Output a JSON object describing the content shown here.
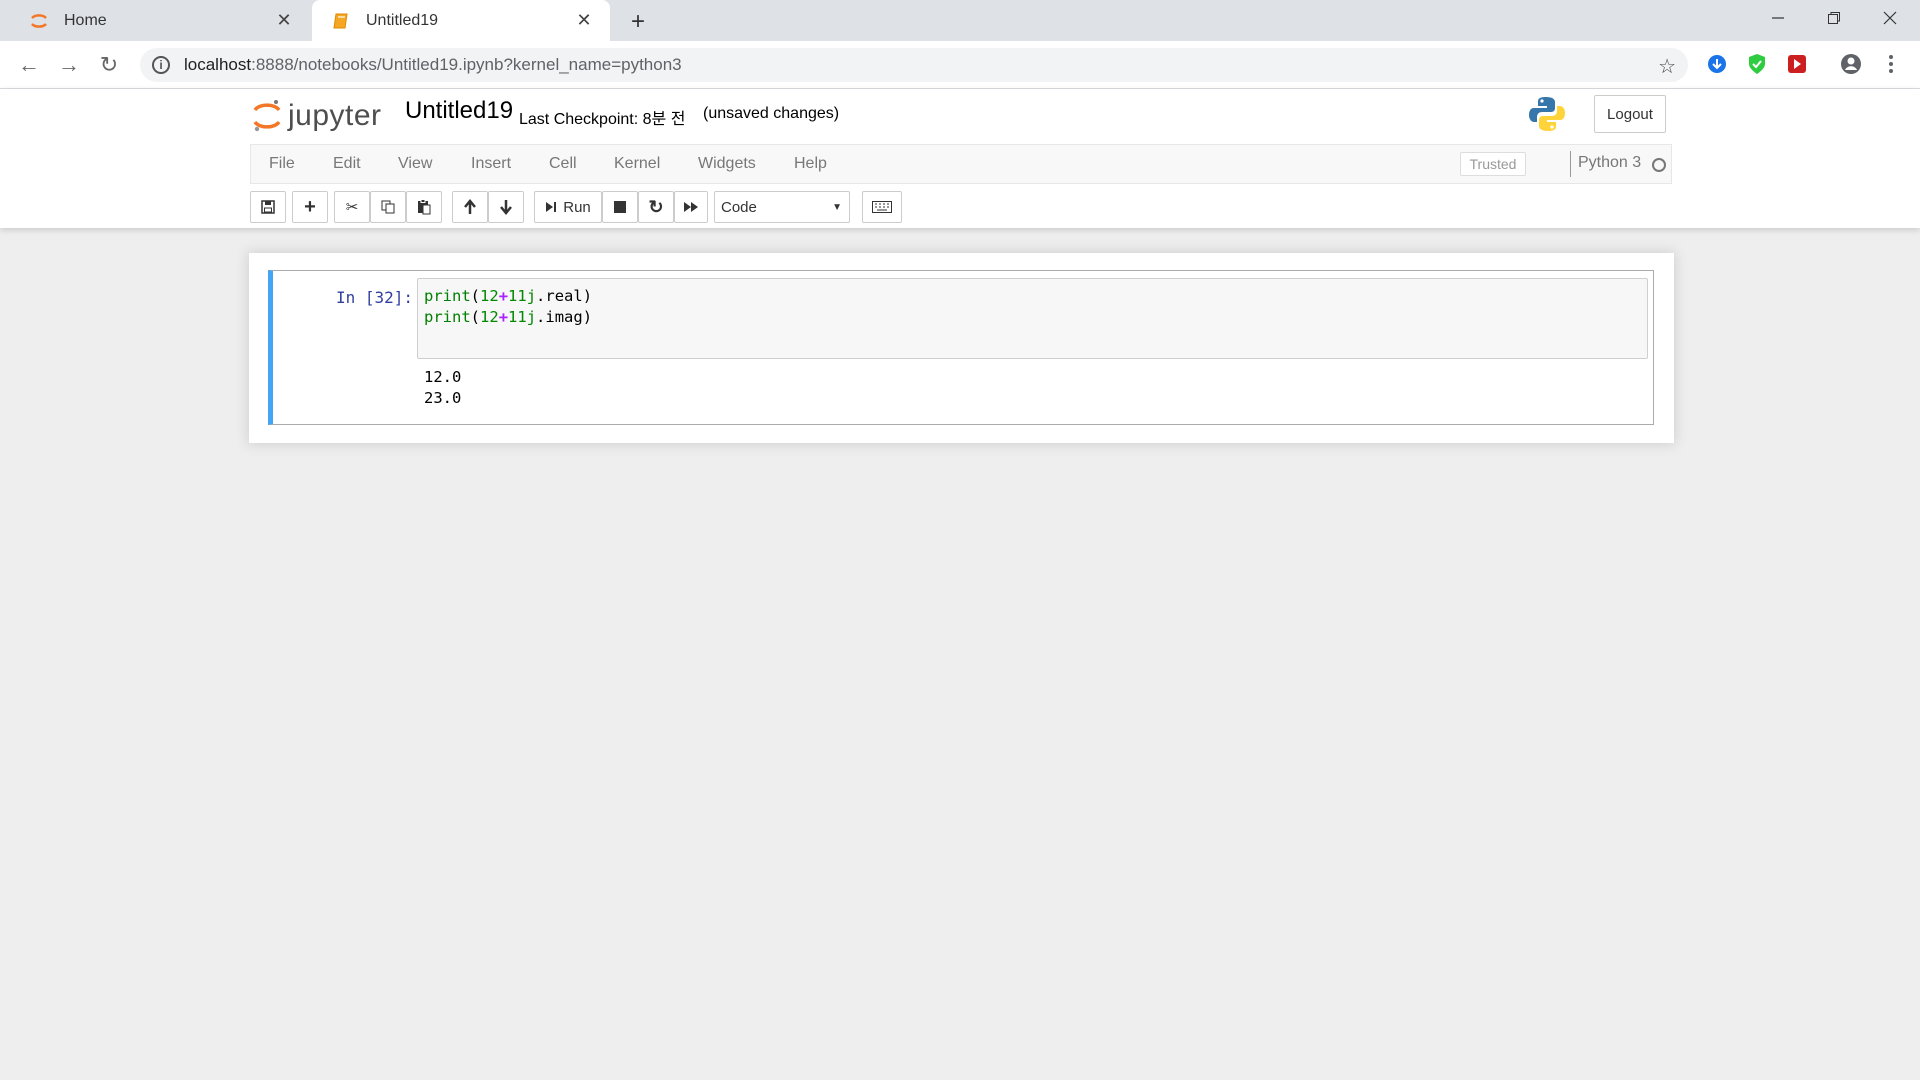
{
  "browser": {
    "tabs": [
      {
        "label": "Home",
        "icon": "jupyter-icon",
        "active": false
      },
      {
        "label": "Untitled19",
        "icon": "notebook-icon",
        "active": true
      }
    ],
    "url": {
      "host": "localhost",
      "rest": ":8888/notebooks/Untitled19.ipynb?kernel_name=python3"
    }
  },
  "header": {
    "logo_text": "jupyter",
    "notebook_name": "Untitled19",
    "checkpoint": "Last Checkpoint: 8분 전",
    "unsaved": "(unsaved changes)",
    "logout": "Logout"
  },
  "menu": {
    "items": [
      "File",
      "Edit",
      "View",
      "Insert",
      "Cell",
      "Kernel",
      "Widgets",
      "Help"
    ],
    "trusted": "Trusted",
    "kernel": "Python 3"
  },
  "toolbar": {
    "run_label": "Run",
    "cell_type": "Code"
  },
  "cell": {
    "prompt": "In [32]:",
    "code": [
      {
        "fn": "print",
        "open": "(",
        "a": "12",
        "op": "+",
        "b": "11j",
        "attr": ".real",
        "close": ")"
      },
      {
        "fn": "print",
        "open": "(",
        "a": "12",
        "op": "+",
        "b": "11j",
        "attr": ".imag",
        "close": ")"
      }
    ],
    "output": [
      "12.0",
      "23.0"
    ]
  },
  "colors": {
    "accent_selected_cell": "#42a5f5",
    "prompt_color": "#303f9f",
    "jupyter_orange": "#f37726"
  }
}
